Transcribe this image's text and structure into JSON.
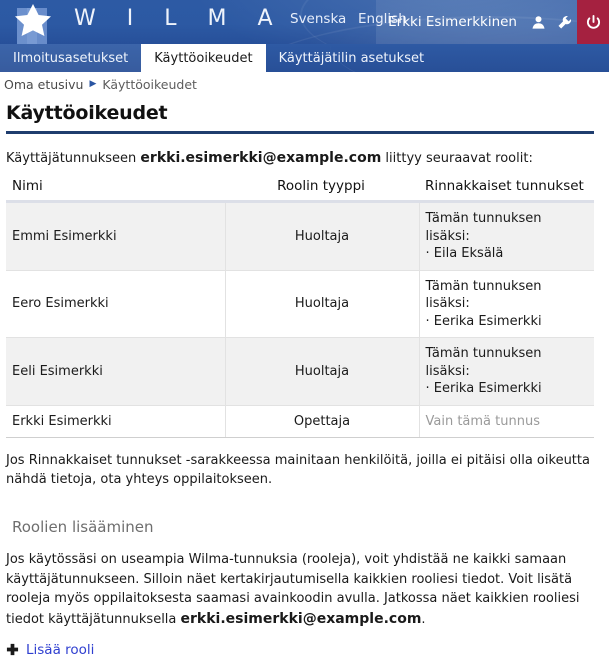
{
  "header": {
    "wordmark": "W I L M A",
    "logo_icon": "star-pillar-logo",
    "languages": [
      {
        "label": "Svenska",
        "name": "language-svenska"
      },
      {
        "label": "English",
        "name": "language-english"
      }
    ],
    "user_name": "Erkki Esimerkkinen",
    "user_icon": "person-icon",
    "settings_icon": "wrench-icon",
    "logout_icon": "power-icon",
    "colors": {
      "header_blue": "#2d5aa4",
      "logout_red": "#a52140",
      "link_blue": "#2f3fd0",
      "rule_navy": "#1f3d6e"
    }
  },
  "tabs": [
    {
      "label": "Ilmoitusasetukset",
      "active": false
    },
    {
      "label": "Käyttöoikeudet",
      "active": true
    },
    {
      "label": "Käyttäjätilin asetukset",
      "active": false
    }
  ],
  "breadcrumb": {
    "home": "Oma etusivu",
    "separator": "▶",
    "current": "Käyttöoikeudet"
  },
  "main": {
    "page_title": "Käyttöoikeudet",
    "intro_prefix": "Käyttäjätunnukseen ",
    "intro_account": "erkki.esimerkki@example.com",
    "intro_suffix": " liittyy seuraavat roolit:",
    "table": {
      "columns": [
        "Nimi",
        "Roolin tyyppi",
        "Rinnakkaiset tunnukset"
      ],
      "rows": [
        {
          "name": "Emmi Esimerkki",
          "role": "Huoltaja",
          "parallel_title": "Tämän tunnuksen lisäksi:",
          "parallel_item": "· Eila Eksälä",
          "parallel_muted": ""
        },
        {
          "name": "Eero Esimerkki",
          "role": "Huoltaja",
          "parallel_title": "Tämän tunnuksen lisäksi:",
          "parallel_item": "· Eerika Esimerkki",
          "parallel_muted": ""
        },
        {
          "name": "Eeli Esimerkki",
          "role": "Huoltaja",
          "parallel_title": "Tämän tunnuksen lisäksi:",
          "parallel_item": "· Eerika Esimerkki",
          "parallel_muted": ""
        },
        {
          "name": "Erkki Esimerkki",
          "role": "Opettaja",
          "parallel_title": "",
          "parallel_item": "",
          "parallel_muted": "Vain tämä tunnus"
        }
      ]
    },
    "note": "Jos Rinnakkaiset tunnukset -sarakkeessa mainitaan henkilöitä, joilla ei pitäisi olla oikeutta nähdä tietoja, ota yhteys oppilaitokseen.",
    "section_heading": "Roolien lisääminen",
    "body_prefix": "Jos käytössäsi on useampia Wilma-tunnuksia (rooleja), voit yhdistää ne kaikki samaan käyttäjätunnukseen. Silloin näet kertakirjautumisella kaikkien rooliesi tiedot. Voit lisätä rooleja myös oppilaitoksesta saamasi avainkoodin avulla. Jatkossa näet kaikkien rooliesi tiedot käyttäjätunnuksella ",
    "body_account": "erkki.esimerkki@example.com",
    "body_suffix": ".",
    "add_role_label": "Lisää rooli",
    "add_role_icon": "plus-icon"
  }
}
